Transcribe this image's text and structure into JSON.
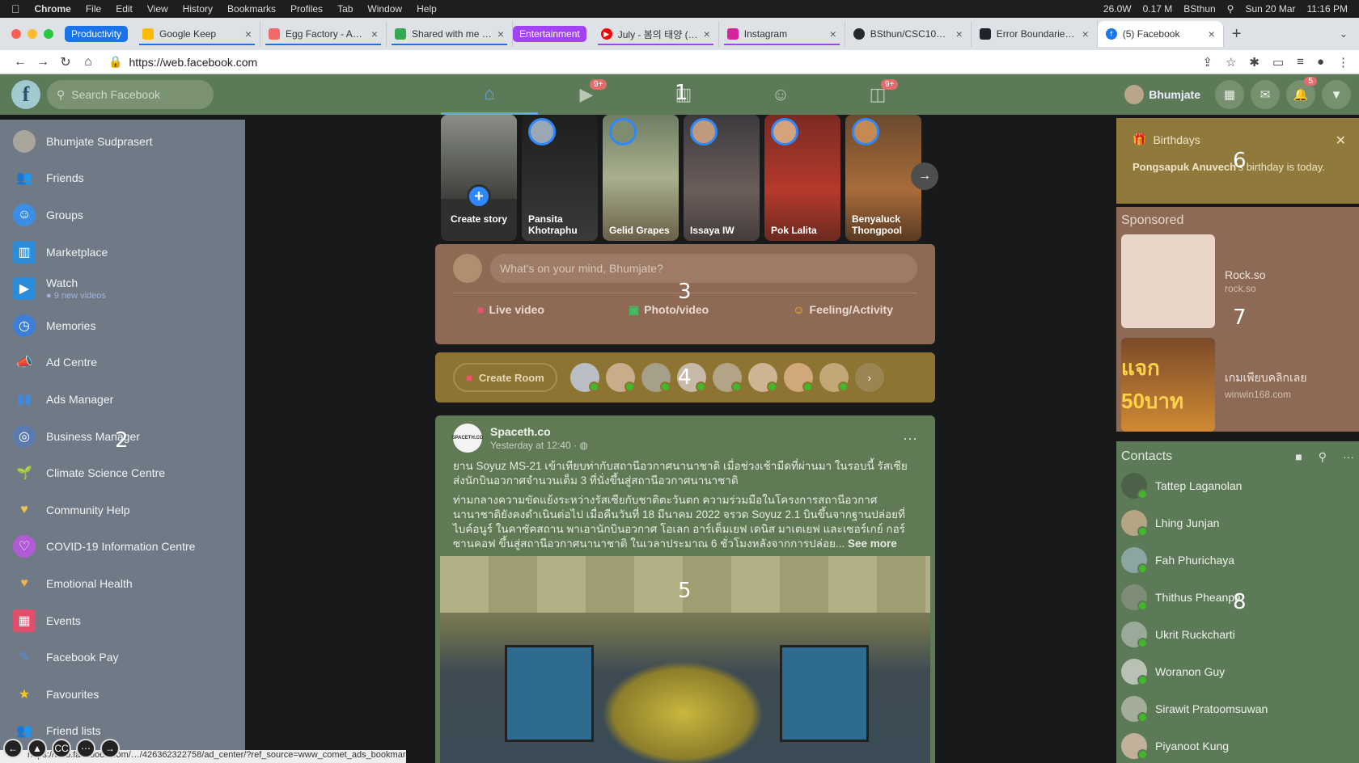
{
  "macbar": {
    "app": "Chrome",
    "menus": [
      "File",
      "Edit",
      "View",
      "History",
      "Bookmarks",
      "Profiles",
      "Tab",
      "Window",
      "Help"
    ],
    "status": [
      "26.0W",
      "0.17 M",
      "BSthun",
      "Sun 20 Mar",
      "11:16 PM"
    ]
  },
  "tabs": {
    "group_productivity": "Productivity",
    "group_entertainment": "Entertainment",
    "items": [
      {
        "title": "Google Keep"
      },
      {
        "title": "Egg Factory - Asana"
      },
      {
        "title": "Shared with me - Google Drive"
      },
      {
        "title": "July - 봄의 태양 (The"
      },
      {
        "title": "Instagram"
      },
      {
        "title": "BSthun/CSC105-Workshop"
      },
      {
        "title": "Error Boundaries – React"
      },
      {
        "title": "(5) Facebook"
      }
    ]
  },
  "addressbar": {
    "url": "https://web.facebook.com"
  },
  "fb_header": {
    "logo": "f",
    "search_placeholder": "Search Facebook",
    "watch_badge": "9+",
    "gaming_badge": "9+",
    "profile_name": "Bhumjate",
    "notif_badge": "5"
  },
  "annotations": [
    "1",
    "2",
    "3",
    "4",
    "5",
    "6",
    "7",
    "8"
  ],
  "left_sidebar": {
    "items": [
      {
        "label": "Bhumjate Sudprasert"
      },
      {
        "label": "Friends"
      },
      {
        "label": "Groups"
      },
      {
        "label": "Marketplace"
      },
      {
        "label": "Watch",
        "sub": "9 new videos"
      },
      {
        "label": "Memories"
      },
      {
        "label": "Ad Centre"
      },
      {
        "label": "Ads Manager"
      },
      {
        "label": "Business Manager"
      },
      {
        "label": "Climate Science Centre"
      },
      {
        "label": "Community Help"
      },
      {
        "label": "COVID-19 Information Centre"
      },
      {
        "label": "Emotional Health"
      },
      {
        "label": "Events"
      },
      {
        "label": "Facebook Pay"
      },
      {
        "label": "Favourites"
      },
      {
        "label": "Friend lists"
      }
    ],
    "status_url": "https://web.facebook.com/…/426362322758/ad_center/?ref_source=www_comet_ads_bookmark"
  },
  "stories": {
    "create_label": "Create story",
    "items": [
      {
        "name": "Pansita Khotraphu"
      },
      {
        "name": "Gelid Grapes"
      },
      {
        "name": "Issaya IW"
      },
      {
        "name": "Pok Lalita"
      },
      {
        "name": "Benyaluck Thongpool"
      }
    ]
  },
  "composer": {
    "placeholder": "What's on your mind, Bhumjate?",
    "live": "Live video",
    "photo": "Photo/video",
    "feeling": "Feeling/Activity"
  },
  "rooms": {
    "create_label": "Create Room"
  },
  "post": {
    "author": "Spaceth.co",
    "avatar_text": "SPACETH.CO",
    "time": "Yesterday at 12:40 ·",
    "p1": "ยาน Soyuz MS-21 เข้าเทียบท่ากับสถานีอวกาศนานาชาติ เมื่อช่วงเช้ามืดที่ผ่านมา ในรอบนี้ รัสเซียส่งนักบินอวกาศจำนวนเต็ม 3 ที่นั่งขึ้นสู่สถานีอวกาศนานาชาติ",
    "p2": "ท่ามกลางความขัดแย้งระหว่างรัสเซียกับชาติตะวันตก ความร่วมมือในโครงการสถานีอวกาศนานาชาติยังคงดำเนินต่อไป เมื่อคืนวันที่ 18 มีนาคม 2022 จรวด Soyuz 2.1 บินขึ้นจากฐานปล่อยที่ไบค์อนูร์ ในคาซัคสถาน พาเอานักบินอวกาศ โอเลก อาร์เต็มเยฟ เดนิส มาเตเยฟ และเซอร์เกย์ กอร์ซานคอฟ ขึ้นสู่สถานีอวกาศนานาชาติ ในเวลาประมาณ 6 ชั่วโมงหลังจากการปล่อย...",
    "see_more": "See more"
  },
  "birthdays": {
    "title": "Birthdays",
    "name": "Pongsapuk Anuvech",
    "text": "'s birthday is today."
  },
  "sponsored": {
    "title": "Sponsored",
    "ads": [
      {
        "name": "Rock.so",
        "url": "rock.so",
        "thumb_text": ""
      },
      {
        "name": "เกมเพียบคลิกเลย",
        "url": "winwin168.com",
        "thumb_text": "แจก 50บาท"
      }
    ]
  },
  "contacts": {
    "title": "Contacts",
    "items": [
      {
        "name": "Tattep Laganolan"
      },
      {
        "name": "Lhing Junjan"
      },
      {
        "name": "Fah Phurichaya"
      },
      {
        "name": "Thithus Pheanpa"
      },
      {
        "name": "Ukrit Ruckcharti"
      },
      {
        "name": "Woranon Guy"
      },
      {
        "name": "Sirawit Pratoomsuwan"
      },
      {
        "name": "Piyanoot Kung"
      }
    ]
  }
}
